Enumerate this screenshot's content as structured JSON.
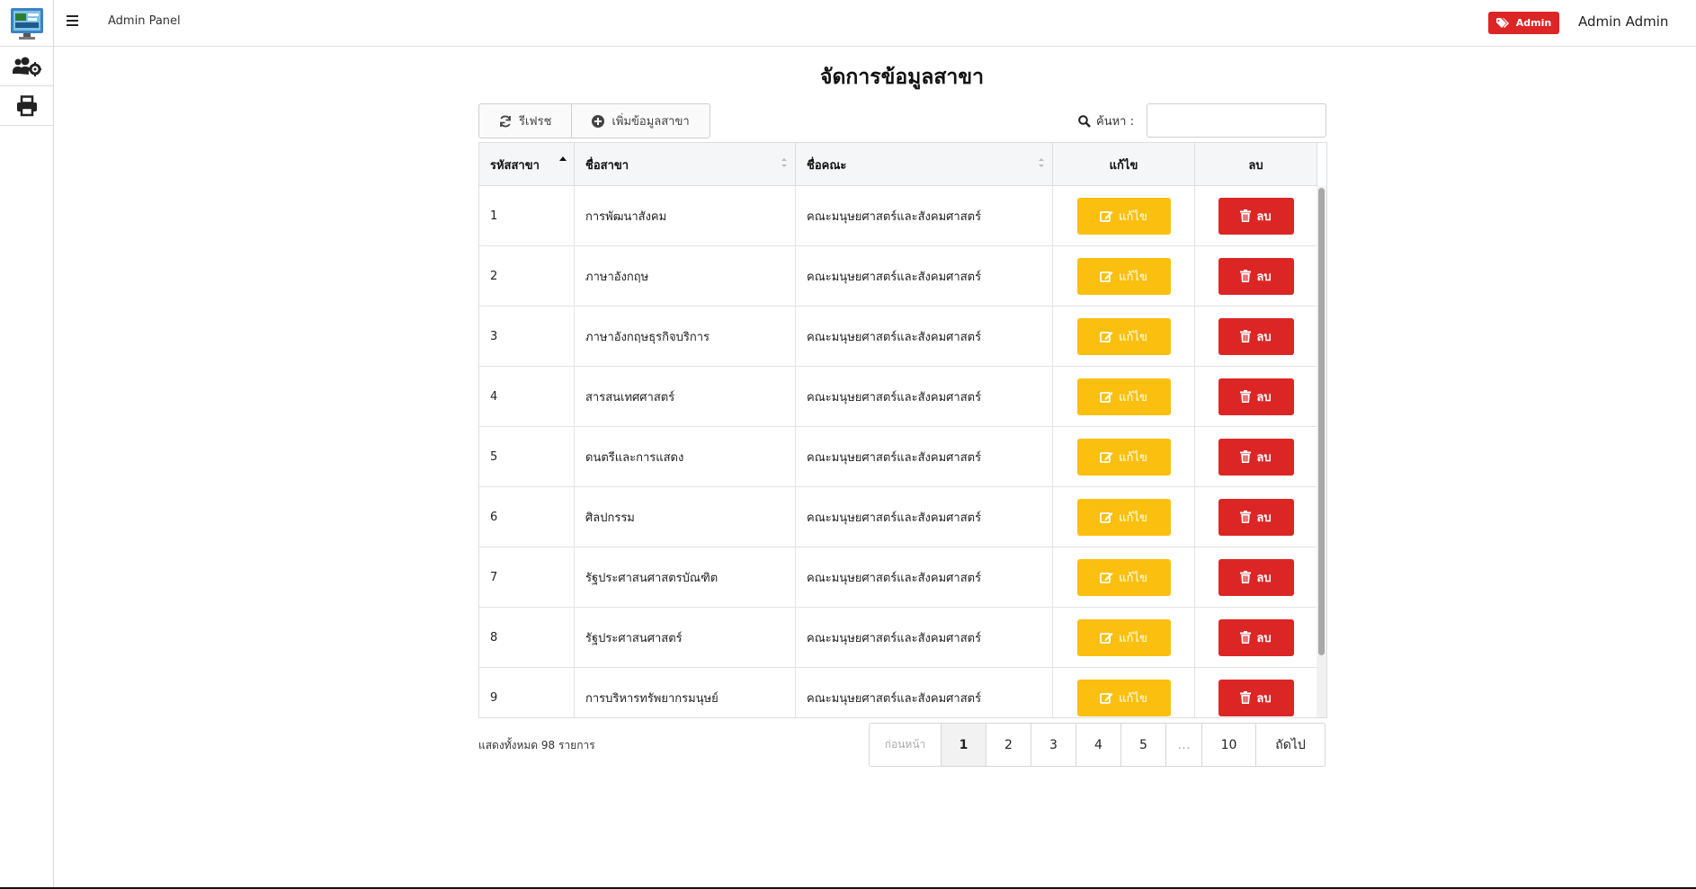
{
  "app": {
    "brand": "Admin Panel",
    "role_badge": "Admin",
    "user_name": "Admin Admin",
    "colors": {
      "danger": "#dc2626",
      "warning": "#fbbf0f"
    }
  },
  "sidebar": {
    "items": [
      {
        "icon": "app-logo-icon"
      },
      {
        "icon": "users-cog-icon"
      },
      {
        "icon": "print-icon"
      }
    ]
  },
  "page": {
    "title": "จัดการข้อมูลสาขา",
    "refresh_label": "รีเฟรช",
    "add_label": "เพิ่มข้อมูลสาขา",
    "search_label": "ค้นหา :",
    "search_value": ""
  },
  "table": {
    "columns": [
      "รหัสสาขา",
      "ชื่อสาขา",
      "ชื่อคณะ",
      "แก้ไข",
      "ลบ"
    ],
    "edit_label": "แก้ไข",
    "delete_label": "ลบ",
    "rows": [
      {
        "id": "1",
        "name": "การพัฒนาสังคม",
        "faculty": "คณะมนุษยศาสตร์และสังคมศาสตร์"
      },
      {
        "id": "2",
        "name": "ภาษาอังกฤษ",
        "faculty": "คณะมนุษยศาสตร์และสังคมศาสตร์"
      },
      {
        "id": "3",
        "name": "ภาษาอังกฤษธุรกิจบริการ",
        "faculty": "คณะมนุษยศาสตร์และสังคมศาสตร์"
      },
      {
        "id": "4",
        "name": "สารสนเทศศาสตร์",
        "faculty": "คณะมนุษยศาสตร์และสังคมศาสตร์"
      },
      {
        "id": "5",
        "name": "ดนตรีและการแสดง",
        "faculty": "คณะมนุษยศาสตร์และสังคมศาสตร์"
      },
      {
        "id": "6",
        "name": "ศิลปกรรม",
        "faculty": "คณะมนุษยศาสตร์และสังคมศาสตร์"
      },
      {
        "id": "7",
        "name": "รัฐประศาสนศาสตรบัณฑิต",
        "faculty": "คณะมนุษยศาสตร์และสังคมศาสตร์"
      },
      {
        "id": "8",
        "name": "รัฐประศาสนศาสตร์",
        "faculty": "คณะมนุษยศาสตร์และสังคมศาสตร์"
      },
      {
        "id": "9",
        "name": "การบริหารทรัพยากรมนุษย์",
        "faculty": "คณะมนุษยศาสตร์และสังคมศาสตร์"
      }
    ]
  },
  "footer": {
    "total_text": "แสดงทั้งหมด 98 รายการ",
    "pagination": {
      "prev": "ก่อนหน้า",
      "pages": [
        "1",
        "2",
        "3",
        "4",
        "5",
        "…",
        "10"
      ],
      "next": "ถัดไป",
      "current": "1"
    }
  }
}
